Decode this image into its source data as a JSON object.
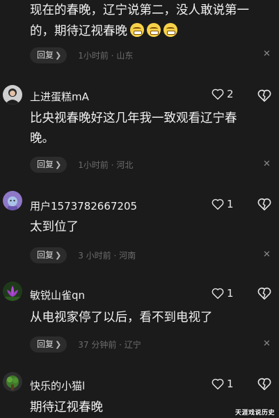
{
  "top_comment": {
    "text_line1": "现在的春晚，辽宁说第二，没人敢说第一",
    "text_line2": "的，期待辽视春晚",
    "emoji_icons": [
      "grinning-face-icon",
      "grinning-face-icon",
      "grinning-face-icon"
    ],
    "reply_label": "回复",
    "time_location": "1小时前 · 山东"
  },
  "comments": [
    {
      "username": "上进蛋糕mA",
      "likes": "2",
      "text": "比央视春晚好这几年我一致观看辽宁春晚。",
      "reply_label": "回复",
      "time_location": "1小时前 · 河北",
      "avatar_icon": "person-avatar-icon"
    },
    {
      "username": "用户1573782667205",
      "likes": "1",
      "text": "太到位了",
      "reply_label": "回复",
      "time_location": "3 小时前 · 河南",
      "avatar_icon": "default-avatar-icon"
    },
    {
      "username": "敏锐山雀qn",
      "likes": "1",
      "text": "从电视家停了以后，看不到电视了",
      "reply_label": "回复",
      "time_location": "37 分钟前 · 辽宁",
      "avatar_icon": "lotus-avatar-icon"
    },
    {
      "username": "快乐的小猫l",
      "likes": "1",
      "text": "期待辽视春晚",
      "avatar_icon": "plant-avatar-icon"
    }
  ],
  "watermark": "天涯戏说历史",
  "colors": {
    "background": "#1b1b1b",
    "reply_bg": "#2c2c2c",
    "meta_text": "#6c6c6c"
  }
}
